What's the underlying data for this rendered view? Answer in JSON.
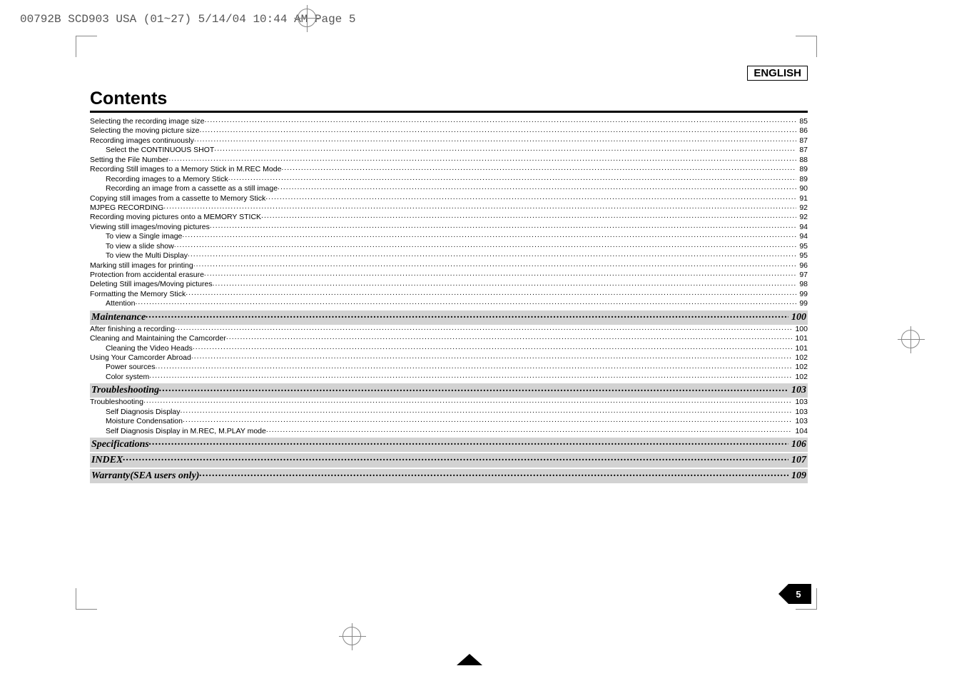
{
  "header_path": "00792B SCD903 USA (01~27)  5/14/04 10:44 AM  Page 5",
  "language_label": "ENGLISH",
  "title": "Contents",
  "page_number": "5",
  "toc": [
    {
      "label": "Selecting the recording image size",
      "page": "85",
      "indent": 0
    },
    {
      "label": "Selecting the moving picture size",
      "page": "86",
      "indent": 0
    },
    {
      "label": "Recording images continuously",
      "page": "87",
      "indent": 0
    },
    {
      "label": "Select the CONTINUOUS SHOT",
      "page": "87",
      "indent": 1
    },
    {
      "label": "Setting the File Number",
      "page": "88",
      "indent": 0
    },
    {
      "label": "Recording Still images to a Memory Stick in M.REC Mode",
      "page": "89",
      "indent": 0
    },
    {
      "label": "Recording images to a Memory Stick",
      "page": "89",
      "indent": 1
    },
    {
      "label": "Recording an image from a cassette as a still image",
      "page": "90",
      "indent": 1
    },
    {
      "label": "Copying still images from a cassette to Memory Stick",
      "page": "91",
      "indent": 0
    },
    {
      "label": "MJPEG RECORDING",
      "page": "92",
      "indent": 0
    },
    {
      "label": "Recording moving pictures onto a MEMORY STICK",
      "page": "92",
      "indent": 0
    },
    {
      "label": "Viewing still images/moving pictures",
      "page": "94",
      "indent": 0
    },
    {
      "label": "To view a Single image",
      "page": "94",
      "indent": 1
    },
    {
      "label": "To view a slide show",
      "page": "95",
      "indent": 1
    },
    {
      "label": "To view the Multi Display",
      "page": "95",
      "indent": 1
    },
    {
      "label": "Marking still images for printing",
      "page": "96",
      "indent": 0
    },
    {
      "label": "Protection from accidental erasure",
      "page": "97",
      "indent": 0
    },
    {
      "label": "Deleting Still images/Moving pictures",
      "page": "98",
      "indent": 0
    },
    {
      "label": "Formatting the Memory Stick",
      "page": "99",
      "indent": 0
    },
    {
      "label": "Attention",
      "page": "99",
      "indent": 1
    }
  ],
  "sections": [
    {
      "heading": {
        "label": "Maintenance",
        "page": "100"
      },
      "items": [
        {
          "label": "After finishing a recording",
          "page": "100",
          "indent": 0
        },
        {
          "label": "Cleaning and Maintaining the Camcorder",
          "page": "101",
          "indent": 0
        },
        {
          "label": "Cleaning the Video Heads",
          "page": "101",
          "indent": 1
        },
        {
          "label": "Using Your Camcorder Abroad",
          "page": "102",
          "indent": 0
        },
        {
          "label": "Power sources",
          "page": "102",
          "indent": 1
        },
        {
          "label": "Color system",
          "page": "102",
          "indent": 1
        }
      ]
    },
    {
      "heading": {
        "label": "Troubleshooting",
        "page": "103"
      },
      "items": [
        {
          "label": "Troubleshooting",
          "page": "103",
          "indent": 0
        },
        {
          "label": "Self Diagnosis Display",
          "page": "103",
          "indent": 1
        },
        {
          "label": "Moisture Condensation",
          "page": "103",
          "indent": 1
        },
        {
          "label": "Self Diagnosis Display in M.REC, M.PLAY mode",
          "page": "104",
          "indent": 1
        }
      ]
    },
    {
      "heading": {
        "label": "Specifications",
        "page": "106"
      },
      "items": []
    },
    {
      "heading": {
        "label": "INDEX",
        "page": "107"
      },
      "items": []
    },
    {
      "heading": {
        "label": "Warranty(SEA users only)",
        "page": "109"
      },
      "items": []
    }
  ]
}
